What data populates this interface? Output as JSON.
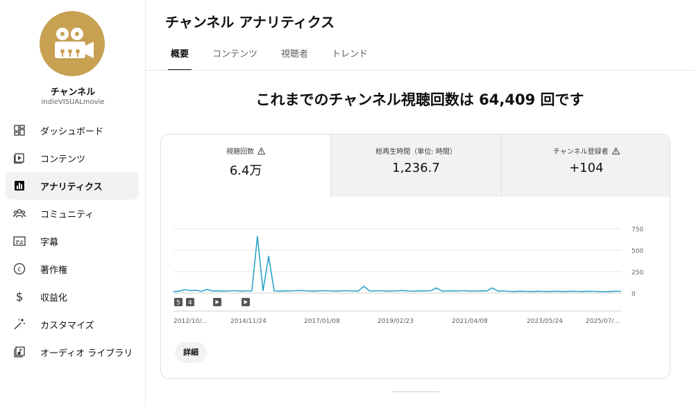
{
  "sidebar": {
    "channel_name": "チャンネル",
    "channel_handle": "indieVISUALmovie",
    "items": [
      {
        "label": "ダッシュボード",
        "icon": "dashboard-icon"
      },
      {
        "label": "コンテンツ",
        "icon": "content-icon"
      },
      {
        "label": "アナリティクス",
        "icon": "analytics-icon",
        "active": true
      },
      {
        "label": "コミュニティ",
        "icon": "community-icon"
      },
      {
        "label": "字幕",
        "icon": "subtitles-icon"
      },
      {
        "label": "著作権",
        "icon": "copyright-icon"
      },
      {
        "label": "収益化",
        "icon": "dollar-icon"
      },
      {
        "label": "カスタマイズ",
        "icon": "magic-wand-icon"
      },
      {
        "label": "オーディオ ライブラリ",
        "icon": "audio-library-icon"
      }
    ]
  },
  "header": {
    "title": "チャンネル アナリティクス",
    "tabs": [
      "概要",
      "コンテンツ",
      "視聴者",
      "トレンド"
    ],
    "active_tab": 0
  },
  "headline": "これまでのチャンネル視聴回数は 64,409 回です",
  "metrics": [
    {
      "label": "視聴回数",
      "value": "6.4万",
      "warning": true
    },
    {
      "label": "総再生時間（単位: 時間）",
      "value": "1,236.7",
      "warning": false
    },
    {
      "label": "チャンネル登録者",
      "value": "+104",
      "warning": true
    }
  ],
  "details_label": "詳細",
  "chart_data": {
    "type": "line",
    "series": [
      {
        "values": [
          18,
          22,
          40,
          28,
          32,
          20,
          42,
          24,
          26,
          22,
          24,
          28,
          22,
          24,
          26,
          660,
          28,
          430,
          24,
          22,
          26,
          24,
          28,
          30,
          24,
          22,
          26,
          28,
          24,
          22,
          26,
          28,
          24,
          22,
          80,
          26,
          24,
          28,
          22,
          24,
          26,
          30,
          24,
          22,
          26,
          24,
          28,
          60,
          22,
          24,
          26,
          24,
          28,
          22,
          24,
          26,
          24,
          60,
          22,
          24,
          20,
          18,
          22,
          20,
          18,
          22,
          20,
          18,
          22,
          20,
          18,
          22,
          20,
          18,
          22,
          20,
          18,
          16,
          18,
          22,
          20
        ]
      }
    ],
    "x_tick_labels": [
      "2012/10/...",
      "2014/11/24",
      "2017/01/08",
      "2019/02/23",
      "2021/04/08",
      "2023/05/24",
      "2025/07/..."
    ],
    "ylim": [
      0,
      750
    ],
    "y_ticks": [
      0,
      250,
      500,
      750
    ],
    "markers": [
      "5",
      "4",
      "play",
      "play"
    ],
    "color": "#2aa3c8"
  }
}
